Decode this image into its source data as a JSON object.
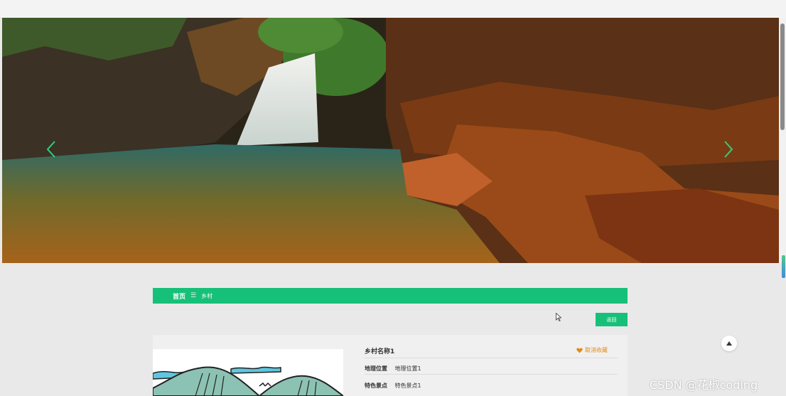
{
  "breadcrumb": {
    "home": "首页",
    "separator": "☰",
    "current": "乡村"
  },
  "back_button": "返回",
  "detail": {
    "title": "乡村名称1",
    "favorite_label": "取消收藏",
    "fields": [
      {
        "label": "地理位置",
        "value": "地理位置1"
      },
      {
        "label": "特色景点",
        "value": "特色景点1"
      }
    ]
  },
  "watermark": "CSDN @花椒coding",
  "icons": {
    "carousel_prev": "chevron-left-icon",
    "carousel_next": "chevron-right-icon",
    "favorite": "heart-icon",
    "back_to_top": "caret-up-icon"
  },
  "colors": {
    "accent": "#17c079",
    "favorite": "#e38a1c"
  }
}
